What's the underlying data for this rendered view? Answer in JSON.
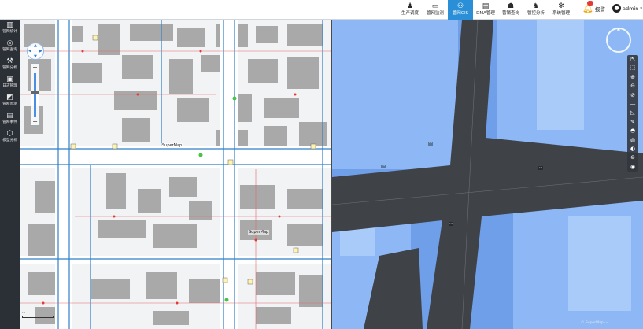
{
  "topnav": {
    "items": [
      {
        "label": "生产调度",
        "icon": "person-icon",
        "glyph": "♟"
      },
      {
        "label": "管网监测",
        "icon": "monitor-icon",
        "glyph": "▭"
      },
      {
        "label": "管网GIS",
        "icon": "gis-person-icon",
        "glyph": "⚇"
      },
      {
        "label": "DMA管理",
        "icon": "folder-icon",
        "glyph": "▤"
      },
      {
        "label": "营销查询",
        "icon": "user-card-icon",
        "glyph": "☗"
      },
      {
        "label": "管控分析",
        "icon": "analysis-icon",
        "glyph": "♞"
      },
      {
        "label": "系统管理",
        "icon": "gear-icon",
        "glyph": "✻"
      }
    ],
    "active": 2,
    "alarm_label": "报警",
    "alarm_badge": "···",
    "user_name": "admin",
    "user_avatar": "●",
    "user_caret": "▾"
  },
  "sidebar": {
    "items": [
      {
        "label": "管网统计",
        "icon": "bar-chart-icon",
        "glyph": "▥"
      },
      {
        "label": "管网查询",
        "icon": "search-icon",
        "glyph": "◎"
      },
      {
        "label": "管网分析",
        "icon": "wrench-icon",
        "glyph": "⚒"
      },
      {
        "label": "日志管理",
        "icon": "log-icon",
        "glyph": "▣"
      },
      {
        "label": "管网监测",
        "icon": "monitor-chart-icon",
        "glyph": "◩"
      },
      {
        "label": "管网事件",
        "icon": "clipboard-icon",
        "glyph": "▤"
      },
      {
        "label": "模型分析",
        "icon": "cube-icon",
        "glyph": "⬡"
      }
    ]
  },
  "map2d": {
    "labels": [
      "SuperMap",
      "SuperMap"
    ],
    "zoom_in": "+",
    "zoom_out": "−",
    "scale_text": "···"
  },
  "map3d": {
    "coords_text": "··· ··· ··· ··· ··· ··· ··· ···",
    "credit": "© SuperMap ···",
    "tools": [
      "⇱",
      "⬚",
      "⊕",
      "⊖",
      "⊘",
      "—",
      "◺",
      "✎",
      "◓",
      "◍",
      "◐",
      "⊛",
      "◉"
    ],
    "tool_names": [
      "select-icon",
      "box-select-icon",
      "zoom-in-icon",
      "zoom-out-icon",
      "clear-icon",
      "measure-line-icon",
      "measure-area-icon",
      "draw-icon",
      "shadow-icon",
      "layers-icon",
      "terrain-icon",
      "globe-icon",
      "location-icon"
    ]
  },
  "colors": {
    "accent": "#2a8fd6",
    "sidebar_bg": "#2b2f36",
    "building_3d": "#7eaef0",
    "road_3d": "#3f4247"
  }
}
